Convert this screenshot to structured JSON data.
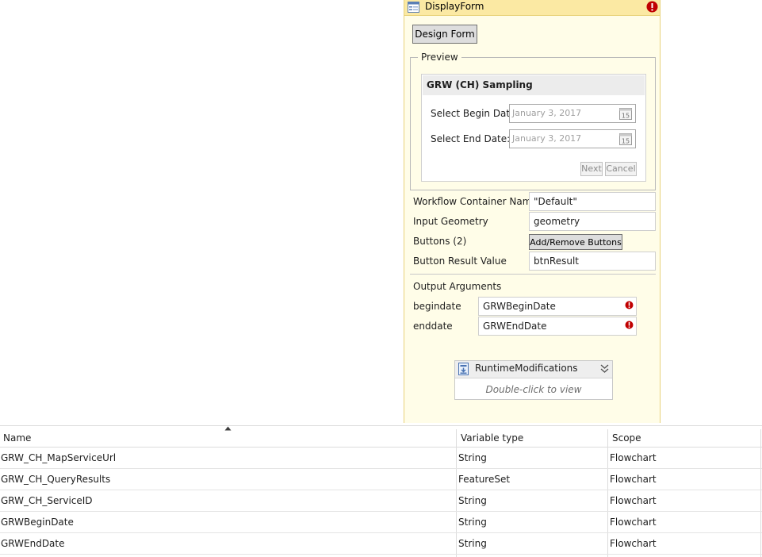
{
  "activity": {
    "title": "DisplayForm",
    "design_button": "Design Form",
    "preview": {
      "legend": "Preview",
      "form_title": "GRW (CH) Sampling",
      "begin_label": "Select Begin Date:",
      "begin_value": "January 3, 2017",
      "end_label": "Select End Date:",
      "end_value": "January 3, 2017",
      "calendar_day": "15",
      "next_button": "Next",
      "cancel_button": "Cancel"
    },
    "properties": {
      "workflow_container_label": "Workflow Container Name",
      "workflow_container_value": "\"Default\"",
      "input_geometry_label": "Input Geometry",
      "input_geometry_value": "geometry",
      "buttons_label": "Buttons (2)",
      "buttons_action": "Add/Remove Buttons",
      "button_result_label": "Button Result Value",
      "button_result_value": "btnResult"
    },
    "output": {
      "heading": "Output Arguments",
      "args": [
        {
          "name": "begindate",
          "value": "GRWBeginDate"
        },
        {
          "name": "enddate",
          "value": "GRWEndDate"
        }
      ]
    },
    "runtime": {
      "title": "RuntimeModifications",
      "hint": "Double-click to view"
    }
  },
  "grid": {
    "columns": [
      "Name",
      "Variable type",
      "Scope"
    ],
    "rows": [
      {
        "name": "GRW_CH_MapServiceUrl",
        "type": "String",
        "scope": "Flowchart"
      },
      {
        "name": "GRW_CH_QueryResults",
        "type": "FeatureSet",
        "scope": "Flowchart"
      },
      {
        "name": "GRW_CH_ServiceID",
        "type": "String",
        "scope": "Flowchart"
      },
      {
        "name": "GRWBeginDate",
        "type": "String",
        "scope": "Flowchart"
      },
      {
        "name": "GRWEndDate",
        "type": "String",
        "scope": "Flowchart"
      }
    ]
  },
  "colors": {
    "activity_bg": "#fffde8",
    "activity_header": "#fbe9a3",
    "error_red": "#c00000"
  }
}
